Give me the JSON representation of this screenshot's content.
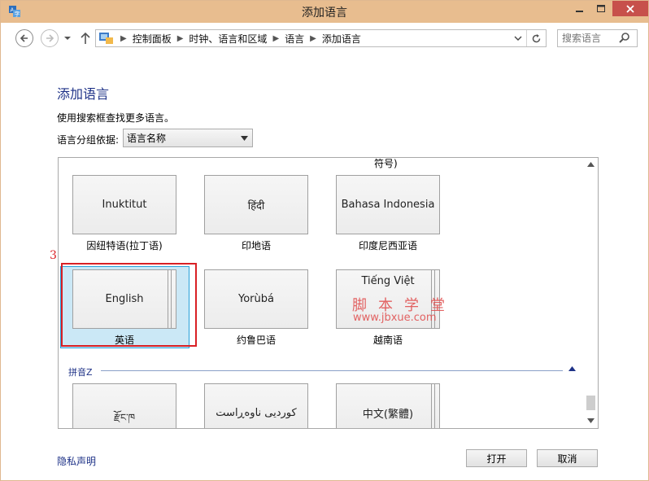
{
  "window": {
    "title": "添加语言"
  },
  "address": {
    "breadcrumbs": [
      "控制面板",
      "时钟、语言和区域",
      "语言",
      "添加语言"
    ],
    "search_placeholder": "搜索语言"
  },
  "content": {
    "title": "添加语言",
    "hint": "使用搜索框查找更多语言。",
    "group_by_label": "语言分组依据:",
    "group_by_value": "语言名称"
  },
  "languages": {
    "partial_label": "符号)",
    "row1": [
      {
        "native": "Inuktitut",
        "caption": "因纽特语(拉丁语)"
      },
      {
        "native": "हिंदी",
        "caption": "印地语"
      },
      {
        "native": "Bahasa Indonesia",
        "caption": "印度尼西亚语"
      }
    ],
    "row2": [
      {
        "native": "English",
        "caption": "英语",
        "selected": true
      },
      {
        "native": "Yorùbá",
        "caption": "约鲁巴语"
      },
      {
        "native": "Tiếng Việt",
        "caption": "越南语"
      }
    ],
    "group_z": "拼音Z",
    "row3": [
      {
        "native": "རྫོང་ཁ"
      },
      {
        "native": "كوردیی ناوەڕاست"
      },
      {
        "native": "中文(繁體)"
      }
    ]
  },
  "annotation": {
    "step_marker": "3"
  },
  "watermark": {
    "text": "脚本学堂",
    "url": "www.jbxue.com"
  },
  "footer": {
    "privacy_link": "隐私声明",
    "open_button": "打开",
    "cancel_button": "取消"
  },
  "colors": {
    "title_bar": "#e8bd8f",
    "close_button": "#c7504b",
    "link": "#1e3287",
    "selection": "#cbe8f6",
    "highlight_box": "#d92025"
  }
}
